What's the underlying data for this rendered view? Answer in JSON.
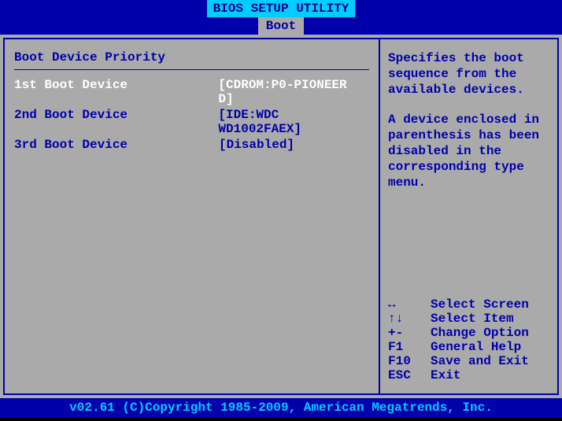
{
  "header": {
    "title": "BIOS SETUP UTILITY",
    "active_tab": "Boot"
  },
  "left_pane": {
    "section_title": "Boot Device Priority",
    "devices": [
      {
        "label": "1st Boot Device",
        "value": "[CDROM:P0-PIONEER D]",
        "selected": true
      },
      {
        "label": "2nd Boot Device",
        "value": "[IDE:WDC WD1002FAEX]",
        "selected": false
      },
      {
        "label": "3rd Boot Device",
        "value": "[Disabled]",
        "selected": false
      }
    ]
  },
  "right_pane": {
    "help_paragraph_1": "Specifies the boot sequence from the available devices.",
    "help_paragraph_2": "A device enclosed in parenthesis has been disabled in the corresponding type menu.",
    "nav": [
      {
        "key": "↔",
        "desc": "Select Screen"
      },
      {
        "key": "↑↓",
        "desc": "Select Item"
      },
      {
        "key": "+-",
        "desc": "Change Option"
      },
      {
        "key": "F1",
        "desc": "General Help"
      },
      {
        "key": "F10",
        "desc": "Save and Exit"
      },
      {
        "key": "ESC",
        "desc": "Exit"
      }
    ]
  },
  "footer": {
    "text": "v02.61 (C)Copyright 1985-2009, American Megatrends, Inc."
  }
}
